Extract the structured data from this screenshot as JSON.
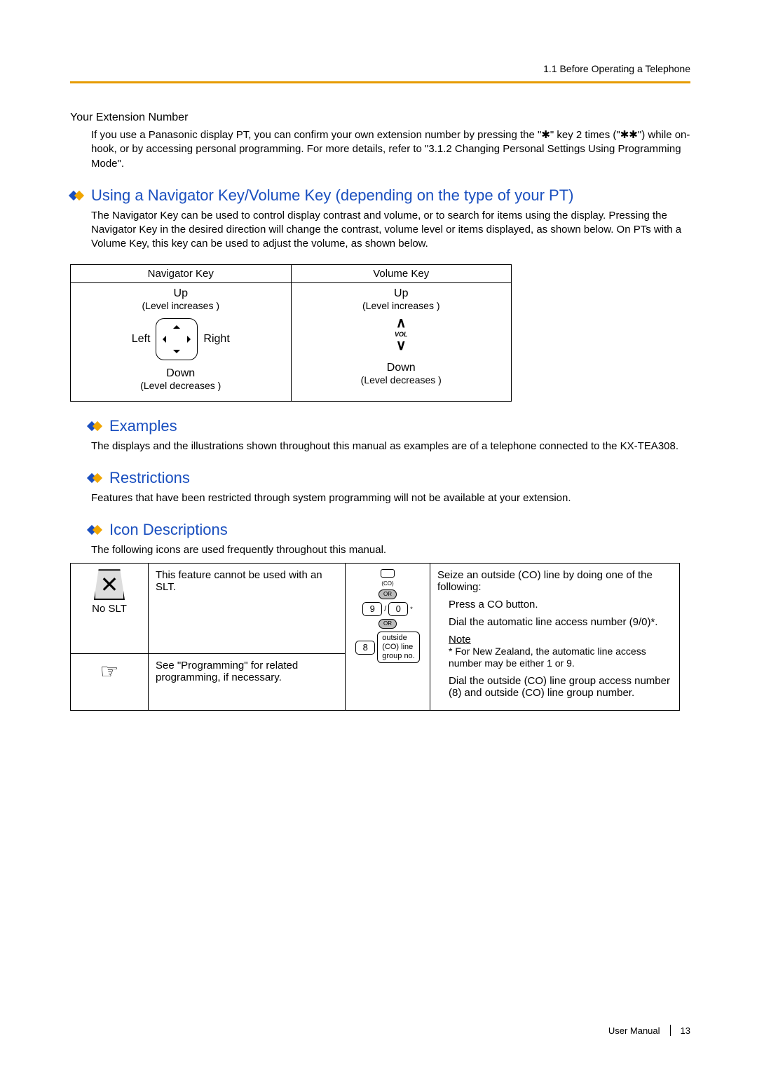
{
  "header": {
    "breadcrumb": "1.1 Before Operating a Telephone"
  },
  "ext": {
    "title": "Your Extension Number",
    "body": "If you use a Panasonic display PT, you can confirm your own extension number by pressing the \"✱\" key 2 times (\"✱✱\") while on-hook, or by accessing personal programming. For more details, refer to \"3.1.2 Changing Personal Settings Using Programming Mode\"."
  },
  "navkey": {
    "title": "Using a Navigator Key/Volume Key (depending on the type of your PT)",
    "body": "The Navigator Key can be used to control display contrast and volume, or to search for items using the display. Pressing the Navigator Key in the desired direction will change the contrast, volume level or items displayed, as shown below. On PTs with a Volume Key, this key can be used to adjust the volume, as shown below.",
    "col1": "Navigator Key",
    "col2": "Volume Key",
    "up": "Up",
    "up_sub": "(Level increases )",
    "down": "Down",
    "down_sub": "(Level decreases )",
    "left": "Left",
    "right": "Right",
    "vol_label": "VOL"
  },
  "examples": {
    "title": "Examples",
    "body": "The displays and the illustrations shown throughout this manual as examples are of a telephone connected to the KX-TEA308."
  },
  "restrictions": {
    "title": "Restrictions",
    "body": "Features that have been restricted through system programming will not be available at your extension."
  },
  "icons": {
    "title": "Icon Descriptions",
    "intro": "The following icons are used frequently throughout this manual.",
    "noslt_label": "No SLT",
    "noslt_desc": "This feature cannot be used with an SLT.",
    "hand_desc": "See \"Programming\" for related programming, if necessary.",
    "co_small": "(CO)",
    "or": "OR",
    "key9": "9",
    "key0": "0",
    "slash": "/",
    "key8": "8",
    "outside_line1": "outside",
    "outside_line2": "(CO) line",
    "outside_line3": "group no.",
    "seize_intro": "Seize an outside (CO) line by doing one of the following:",
    "seize_opt1": "Press a CO button.",
    "seize_opt2": "Dial the automatic line access number (9/0)*.",
    "seize_note_label": "Note",
    "seize_note_body": "* For New Zealand, the automatic line access number may be either 1 or 9.",
    "seize_opt3": "Dial the outside (CO) line group access number (8) and outside (CO) line group number."
  },
  "footer": {
    "manual": "User Manual",
    "page": "13"
  }
}
